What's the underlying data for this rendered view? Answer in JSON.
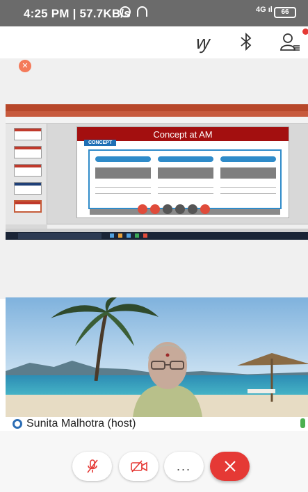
{
  "status_bar": {
    "time": "4:25 PM | 57.7KB/s",
    "network": "4G",
    "battery": "66"
  },
  "top_bar": {
    "draw_icon": "annotate-icon",
    "bluetooth_icon": "bluetooth-icon",
    "participants_icon": "participants-icon",
    "notification_color": "#e53935"
  },
  "shared_screen": {
    "slide_title": "Concept at AM",
    "slide_section": "CONCEPT",
    "app_accent": "#b7472a"
  },
  "participant": {
    "name": "Sunita Malhotra (host)"
  },
  "controls": {
    "mute": "mic-off-icon",
    "video": "video-off-icon",
    "more": "...",
    "end": "close-icon",
    "end_color": "#e53935"
  }
}
